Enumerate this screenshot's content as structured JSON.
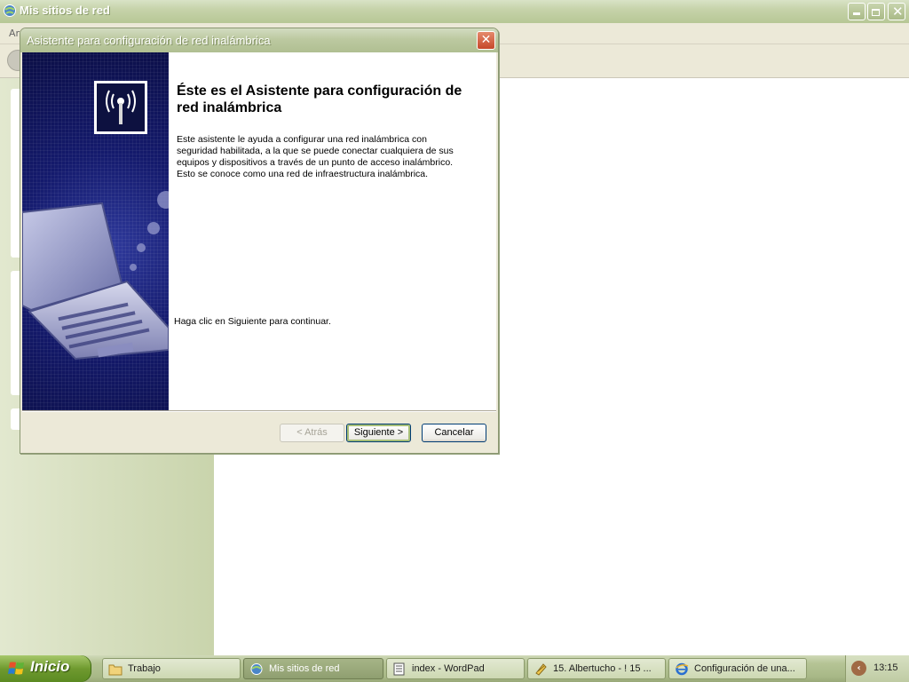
{
  "main_window": {
    "title": "Mis sitios de red",
    "menu_partial": "Ar"
  },
  "wizard": {
    "title": "Asistente para configuración de red inalámbrica",
    "heading": "Éste es el Asistente para configuración de red inalámbrica",
    "description": "Este asistente le ayuda a configurar una red inalámbrica con seguridad habilitada, a la que se puede conectar cualquiera de sus equipos y dispositivos a través de un punto de acceso inalámbrico. Esto se conoce como una red de infraestructura inalámbrica.",
    "continue_text": "Haga clic en Siguiente para continuar.",
    "buttons": {
      "back": "< Atrás",
      "next": "Siguiente >",
      "cancel": "Cancelar"
    },
    "close_glyph": "✕"
  },
  "taskbar": {
    "start_label": "Inicio",
    "items": [
      {
        "label": "Trabajo",
        "icon": "folder-icon",
        "active": false
      },
      {
        "label": "Mis sitios de red",
        "icon": "network-places-icon",
        "active": true
      },
      {
        "label": "index - WordPad",
        "icon": "wordpad-icon",
        "active": false
      },
      {
        "label": "15. Albertucho - ! 15 ...",
        "icon": "media-file-icon",
        "active": false
      },
      {
        "label": "Configuración de una...",
        "icon": "internet-explorer-icon",
        "active": false
      }
    ],
    "clock": "13:15"
  },
  "colors": {
    "titlebar_olive": "#b7c795",
    "wizard_sidebar": "#141a6c",
    "start_green": "#6f9a2f"
  }
}
